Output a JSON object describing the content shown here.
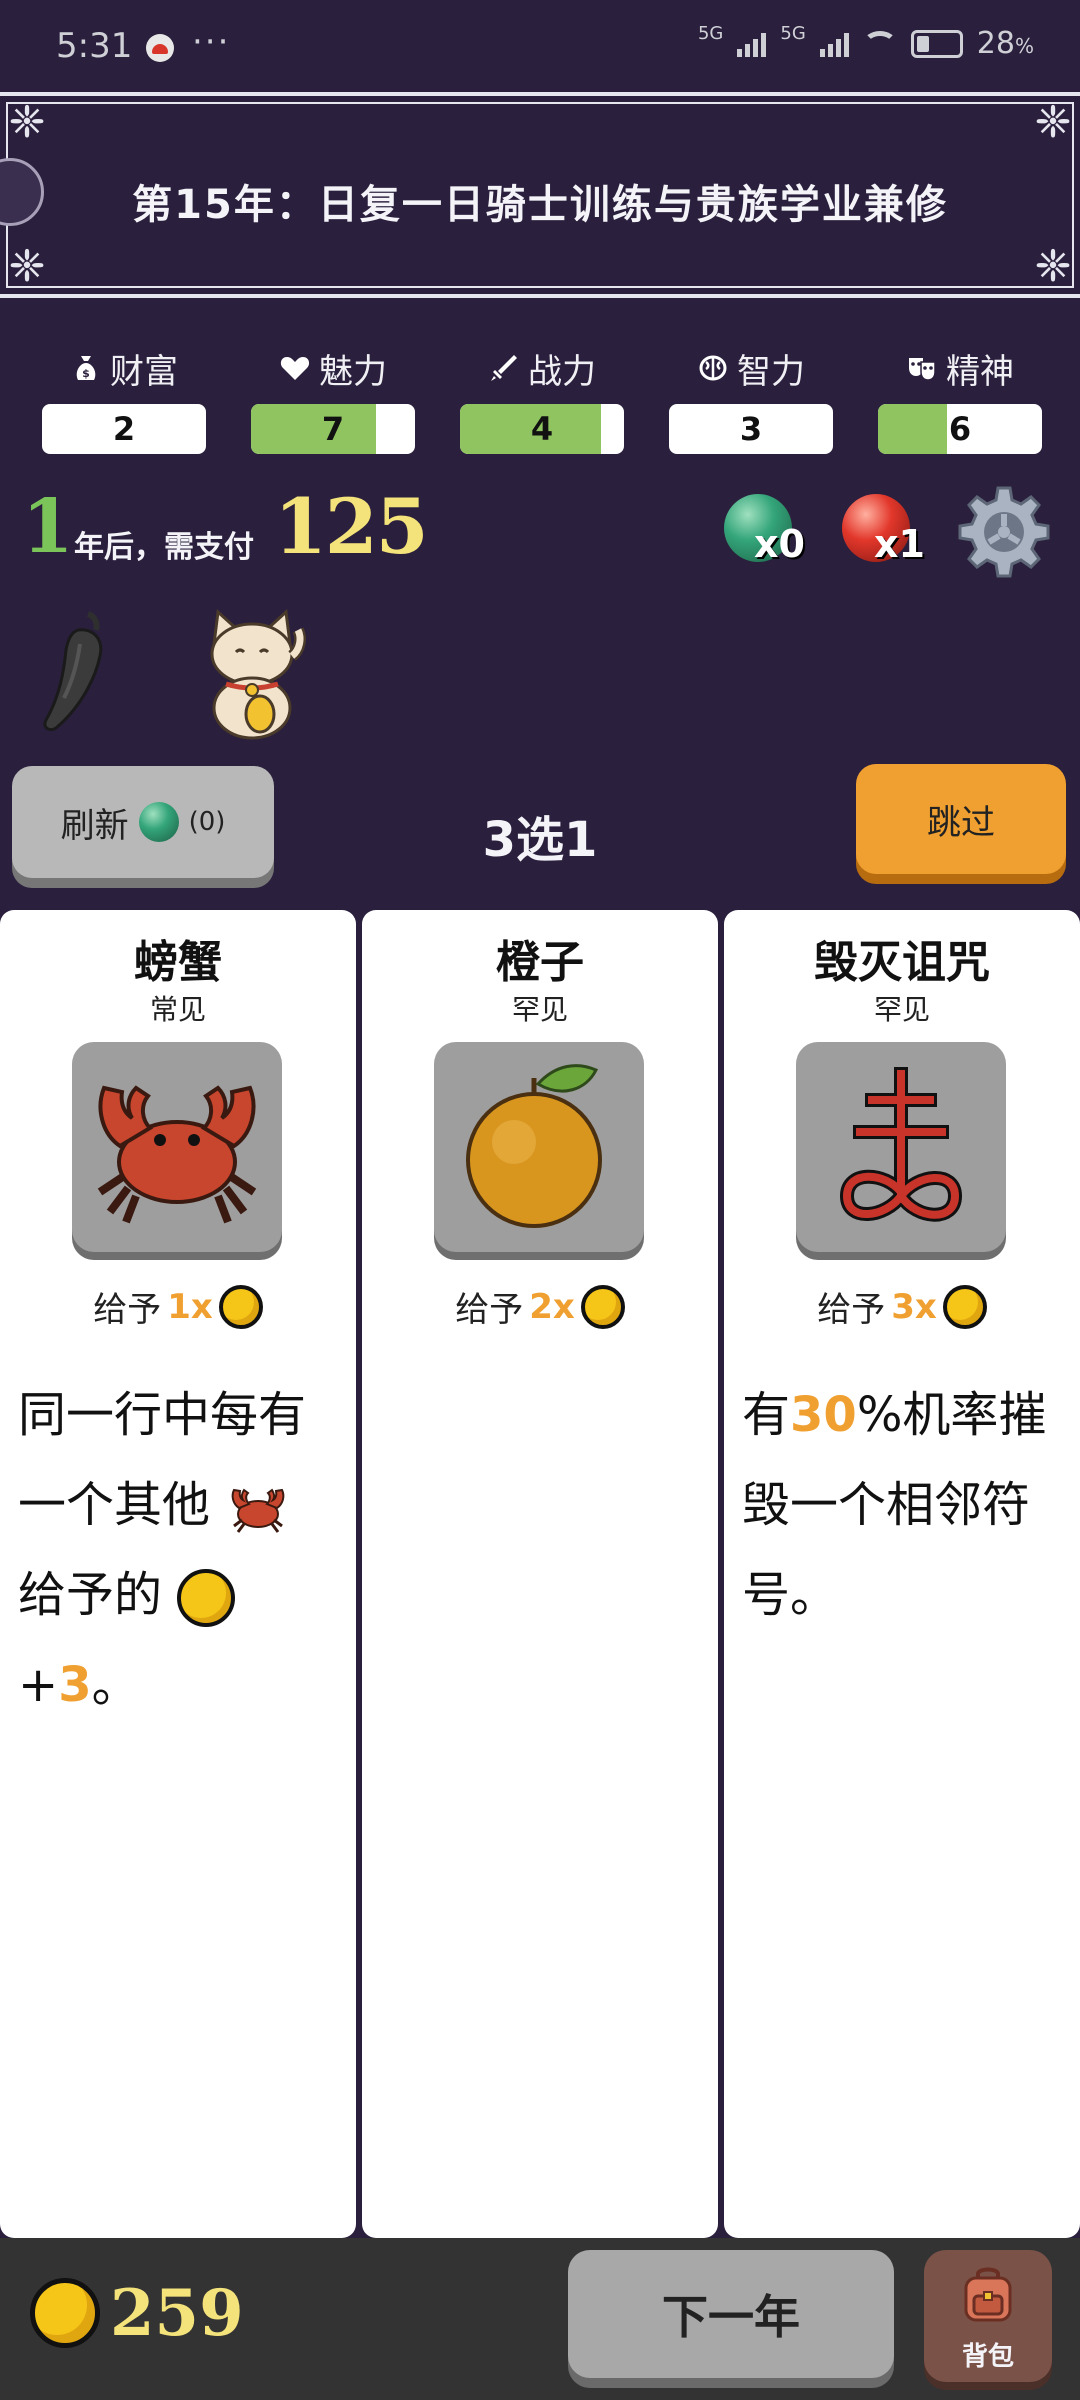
{
  "status_bar": {
    "time": "5:31",
    "dots": "···",
    "network1": "5G",
    "network2": "5G",
    "battery": "28",
    "battery_unit": "%"
  },
  "banner": {
    "title": "第15年：日复一日骑士训练与贵族学业兼修"
  },
  "stats": [
    {
      "label": "财富",
      "icon": "money-bag-icon",
      "value": "2",
      "fill_fraction": 0
    },
    {
      "label": "魅力",
      "icon": "heart-icon",
      "value": "7",
      "fill_fraction": 0.76
    },
    {
      "label": "战力",
      "icon": "sword-icon",
      "value": "4",
      "fill_fraction": 0.86
    },
    {
      "label": "智力",
      "icon": "brain-icon",
      "value": "3",
      "fill_fraction": 0
    },
    {
      "label": "精神",
      "icon": "mask-icon",
      "value": "6",
      "fill_fraction": 0.42
    }
  ],
  "payment": {
    "years": "1",
    "text": "年后，需支付",
    "amount": "125"
  },
  "orbs": {
    "green_count": "x0",
    "red_count": "x1"
  },
  "owned_items": [
    {
      "icon": "chili-pepper-icon"
    },
    {
      "icon": "lucky-cat-icon"
    }
  ],
  "actions": {
    "refresh_label": "刷新",
    "refresh_count": "(0)",
    "pick_label": "3选1",
    "skip_label": "跳过"
  },
  "cards": [
    {
      "name": "螃蟹",
      "rarity": "常见",
      "icon": "crab-icon",
      "give_label": "给予",
      "multiplier": "1x",
      "desc": {
        "a": "同一行中每有一个其他",
        "b": "给予的",
        "c": "+",
        "d": "3",
        "e": "。"
      }
    },
    {
      "name": "橙子",
      "rarity": "罕见",
      "icon": "orange-icon",
      "give_label": "给予",
      "multiplier": "2x",
      "desc": {}
    },
    {
      "name": "毁灭诅咒",
      "rarity": "罕见",
      "icon": "leviathan-cross-icon",
      "give_label": "给予",
      "multiplier": "3x",
      "desc": {
        "a": "有",
        "b": "30",
        "c": "%机率摧毁一个相邻符号。"
      }
    }
  ],
  "bottom": {
    "gold": "259",
    "next_label": "下一年",
    "bag_label": "背包"
  },
  "colors": {
    "background": "#2a1f3d",
    "stat_fill": "#8fc460",
    "accent_orange": "#f0a030",
    "gold_text": "#f4e37a",
    "years_green": "#7bc45a"
  }
}
